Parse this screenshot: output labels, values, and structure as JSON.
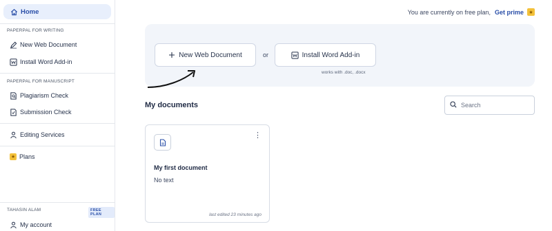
{
  "sidebar": {
    "home_label": "Home",
    "section_writing": "PAPERPAL FOR WRITING",
    "writing_items": [
      {
        "label": "New Web Document",
        "icon": "pen-icon"
      },
      {
        "label": "Install Word Add-in",
        "icon": "word-addin-icon"
      }
    ],
    "section_manuscript": "PAPERPAL FOR MANUSCRIPT",
    "manuscript_items": [
      {
        "label": "Plagiarism Check",
        "icon": "plagiarism-icon"
      },
      {
        "label": "Submission Check",
        "icon": "submission-check-icon"
      }
    ],
    "editing_services_label": "Editing Services",
    "plans_label": "Plans",
    "user_name": "TAHASIN ALAM",
    "plan_badge": "FREE PLAN",
    "my_account_label": "My account"
  },
  "topbar": {
    "plan_text": "You are currently on free plan,",
    "upgrade_link": "Get prime"
  },
  "actions": {
    "new_doc_label": "New Web Document",
    "or_text": "or",
    "install_label": "Install Word Add-in",
    "install_hint": "works with .doc, .docx"
  },
  "documents": {
    "heading": "My documents",
    "search_placeholder": "Search",
    "items": [
      {
        "title": "My first document",
        "preview": "No text",
        "edited": "last edited 23 minutes ago"
      }
    ]
  },
  "colors": {
    "accent": "#2a4fa8",
    "home_bg": "#e8effc",
    "panel_bg": "#f2f5fa",
    "star": "#f3c13a"
  }
}
